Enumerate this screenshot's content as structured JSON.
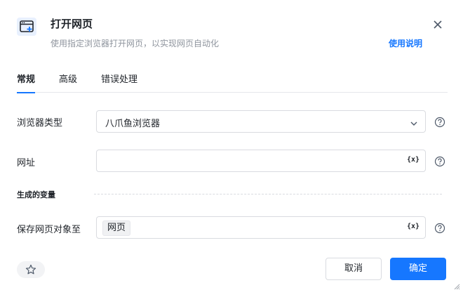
{
  "header": {
    "icon": "browser-add-icon",
    "title": "打开网页",
    "subtitle": "使用指定浏览器打开网页，以实现网页自动化",
    "help_link": "使用说明"
  },
  "tabs": [
    {
      "label": "常规",
      "active": true
    },
    {
      "label": "高级",
      "active": false
    },
    {
      "label": "错误处理",
      "active": false
    }
  ],
  "form": {
    "browser_type": {
      "label": "浏览器类型",
      "value": "八爪鱼浏览器"
    },
    "url": {
      "label": "网址",
      "value": "",
      "var_button": "{x}"
    },
    "section_title": "生成的变量",
    "save_to": {
      "label": "保存网页对象至",
      "tag": "网页",
      "var_button": "{x}"
    }
  },
  "footer": {
    "cancel_label": "取消",
    "ok_label": "确定"
  },
  "colors": {
    "accent": "#1677ff",
    "text": "#1f2329",
    "muted": "#8f959e",
    "border": "#d9dbe0"
  }
}
